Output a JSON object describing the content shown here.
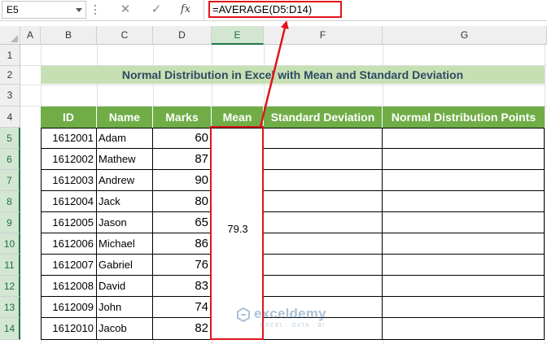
{
  "formula_bar": {
    "name_box": "E5",
    "cancel_icon": "✕",
    "enter_icon": "✓",
    "fx_label": "fx",
    "formula": "=AVERAGE(D5:D14)"
  },
  "columns": [
    "A",
    "B",
    "C",
    "D",
    "E",
    "F",
    "G"
  ],
  "active_column": "E",
  "rows": [
    "1",
    "2",
    "3",
    "4",
    "5",
    "6",
    "7",
    "8",
    "9",
    "10",
    "11",
    "12",
    "13",
    "14"
  ],
  "active_rows": [
    "5",
    "6",
    "7",
    "8",
    "9",
    "10",
    "11",
    "12",
    "13",
    "14"
  ],
  "title": "Normal Distribution in Excel with Mean and Standard Deviation",
  "table": {
    "headers": [
      "ID",
      "Name",
      "Marks",
      "Mean",
      "Standard Deviation",
      "Normal Distribution Points"
    ],
    "rows": [
      {
        "id": "1612001",
        "name": "Adam",
        "marks": "60"
      },
      {
        "id": "1612002",
        "name": "Mathew",
        "marks": "87"
      },
      {
        "id": "1612003",
        "name": "Andrew",
        "marks": "90"
      },
      {
        "id": "1612004",
        "name": "Jack",
        "marks": "80"
      },
      {
        "id": "1612005",
        "name": "Jason",
        "marks": "65"
      },
      {
        "id": "1612006",
        "name": "Michael",
        "marks": "86"
      },
      {
        "id": "1612007",
        "name": "Gabriel",
        "marks": "76"
      },
      {
        "id": "1612008",
        "name": "David",
        "marks": "83"
      },
      {
        "id": "1612009",
        "name": "John",
        "marks": "74"
      },
      {
        "id": "1612010",
        "name": "Jacob",
        "marks": "82"
      }
    ],
    "mean_value": "79.3"
  },
  "watermark": {
    "name": "exceldemy",
    "tagline": "EXCEL · DATA · BI"
  },
  "colors": {
    "header_green": "#70ad47",
    "title_band": "#c6e0b4",
    "title_text": "#2e4a63",
    "highlight_red": "#e0141a",
    "active_header": "#217346"
  }
}
